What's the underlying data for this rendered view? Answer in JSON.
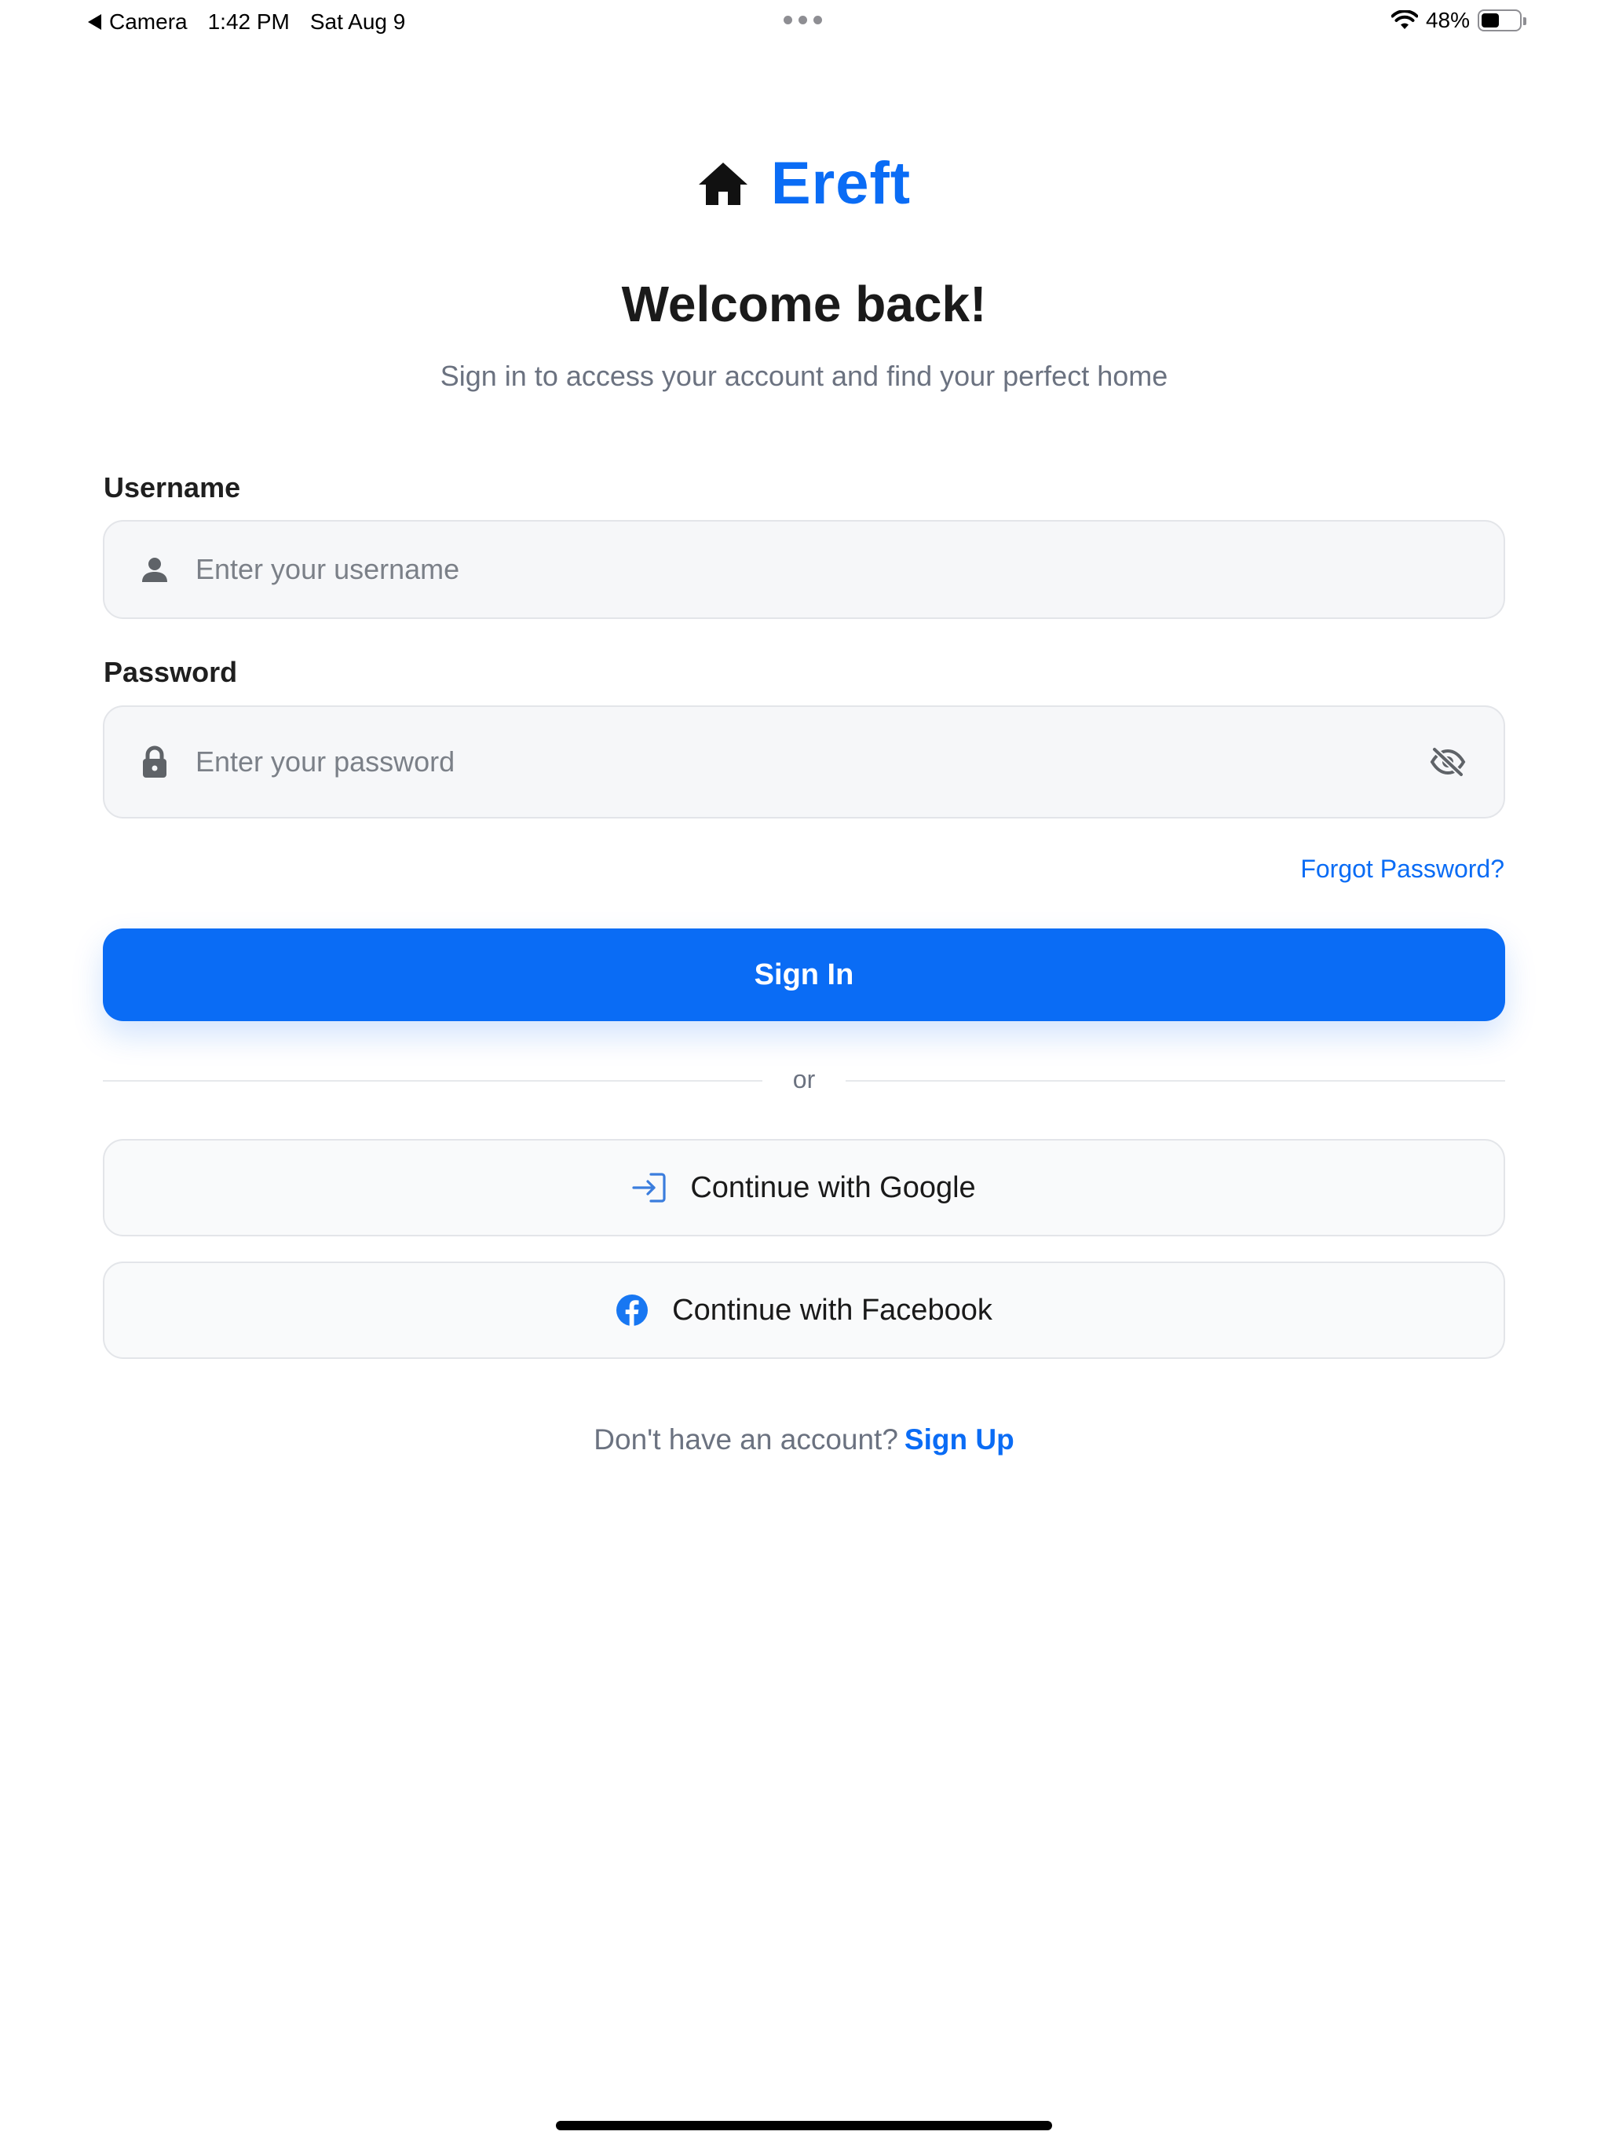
{
  "status_bar": {
    "back_app": "Camera",
    "time": "1:42 PM",
    "date": "Sat Aug 9",
    "battery_percent": "48%",
    "battery_level": 0.48
  },
  "brand": {
    "name": "Ereft",
    "icon": "home-icon",
    "accent_color": "#0a6cf5"
  },
  "header": {
    "title": "Welcome back!",
    "subtitle": "Sign in to access your account and find your perfect home"
  },
  "form": {
    "username": {
      "label": "Username",
      "placeholder": "Enter your username",
      "value": "",
      "icon": "person-icon"
    },
    "password": {
      "label": "Password",
      "placeholder": "Enter your password",
      "value": "",
      "icon": "lock-icon",
      "toggle_icon": "eye-off-icon"
    },
    "forgot_label": "Forgot Password?",
    "submit_label": "Sign In"
  },
  "divider_label": "or",
  "social": {
    "google_label": "Continue with Google",
    "google_icon": "sign-in-arrow-icon",
    "facebook_label": "Continue with Facebook",
    "facebook_icon": "facebook-icon",
    "facebook_color": "#1877f2"
  },
  "footer": {
    "prompt": "Don't have an account?",
    "signup_label": "Sign Up"
  }
}
